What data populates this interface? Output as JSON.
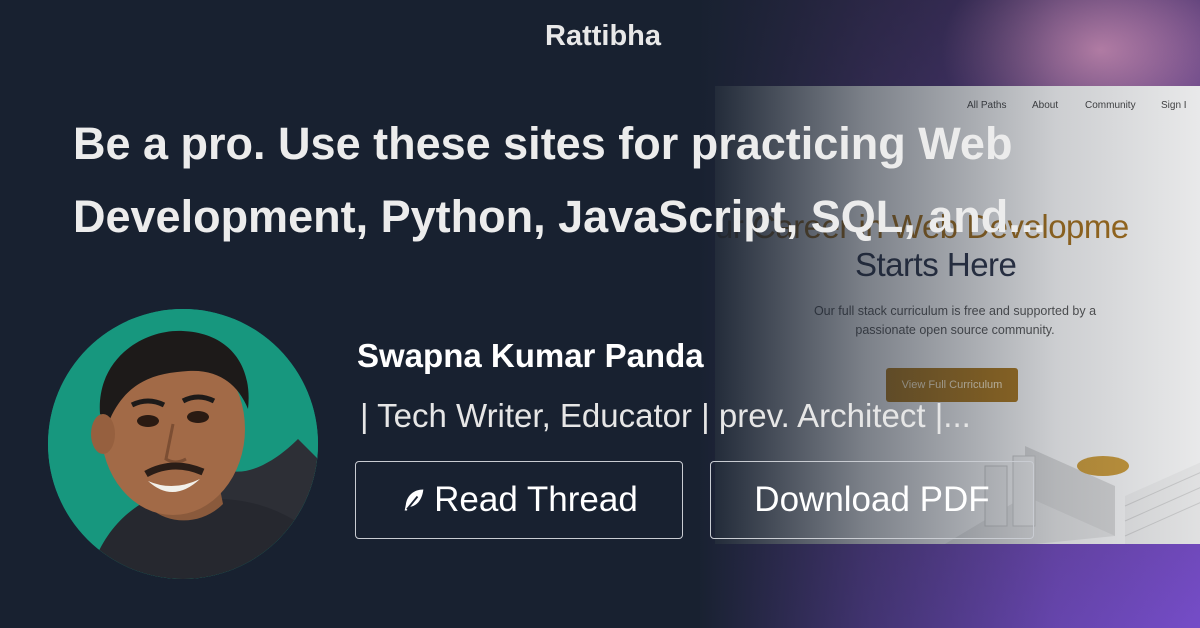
{
  "brand": {
    "name": "Rattibha"
  },
  "thread": {
    "title": "Be a pro. Use these sites for practicing Web Development, Python, JavaScript, SQL, and..."
  },
  "author": {
    "name": "Swapna Kumar Panda",
    "bio": "| Tech Writer, Educator | prev. Architect |..."
  },
  "actions": {
    "read_thread_label": "Read Thread",
    "download_pdf_label": "Download PDF"
  },
  "preview": {
    "nav": [
      "All Paths",
      "About",
      "Community",
      "Sign I"
    ],
    "headline_line1": "ur Career in Web Developme",
    "headline_line2": "Starts Here",
    "subtext": "Our full stack curriculum is free and supported by a passionate open source community.",
    "cta_label": "View Full Curriculum"
  },
  "colors": {
    "background": "#182130",
    "avatar_ring": "#17977e",
    "preview_accent": "#a8761f",
    "preview_gradient": "#6a44a8"
  },
  "icons": {
    "read_thread": "feather-icon"
  }
}
